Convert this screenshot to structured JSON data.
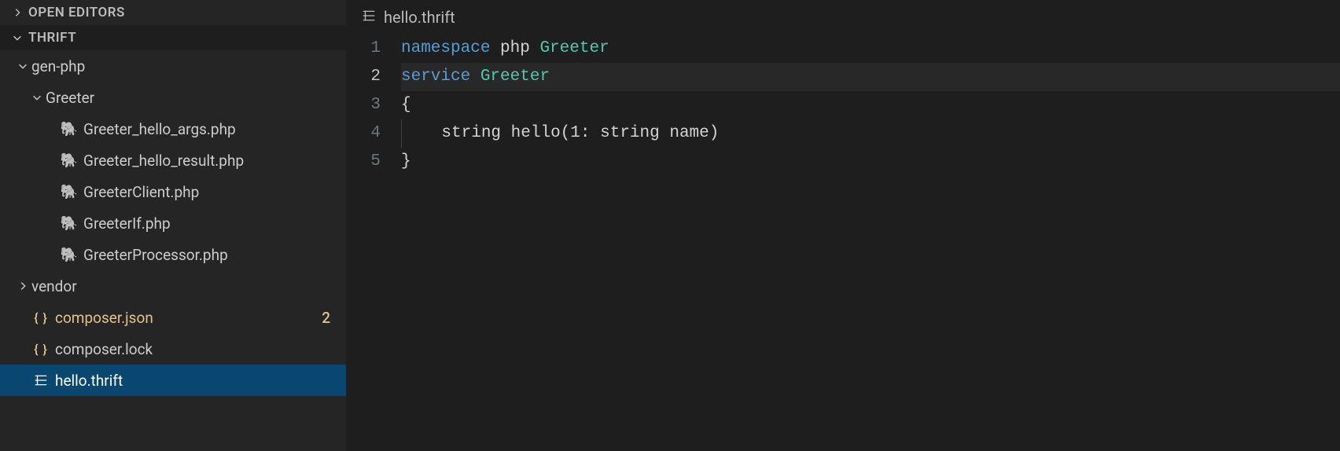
{
  "sidebar": {
    "open_editors_label": "OPEN EDITORS",
    "workspace_label": "THRIFT",
    "tree": [
      {
        "kind": "folder",
        "name": "gen-php",
        "depth": 0,
        "expanded": true
      },
      {
        "kind": "folder",
        "name": "Greeter",
        "depth": 1,
        "expanded": true
      },
      {
        "kind": "file",
        "name": "Greeter_hello_args.php",
        "depth": 2,
        "icon": "php"
      },
      {
        "kind": "file",
        "name": "Greeter_hello_result.php",
        "depth": 2,
        "icon": "php"
      },
      {
        "kind": "file",
        "name": "GreeterClient.php",
        "depth": 2,
        "icon": "php"
      },
      {
        "kind": "file",
        "name": "GreeterIf.php",
        "depth": 2,
        "icon": "php"
      },
      {
        "kind": "file",
        "name": "GreeterProcessor.php",
        "depth": 2,
        "icon": "php"
      },
      {
        "kind": "folder",
        "name": "vendor",
        "depth": 0,
        "expanded": false
      },
      {
        "kind": "file",
        "name": "composer.json",
        "depth": 0,
        "icon": "json",
        "modified": true,
        "badge": "2"
      },
      {
        "kind": "file",
        "name": "composer.lock",
        "depth": 0,
        "icon": "json"
      },
      {
        "kind": "file",
        "name": "hello.thrift",
        "depth": 0,
        "icon": "thrift",
        "selected": true
      }
    ]
  },
  "editor": {
    "tab_filename": "hello.thrift",
    "current_line": 2,
    "lines": [
      {
        "n": 1,
        "tokens": [
          {
            "t": "namespace",
            "c": "keyword"
          },
          {
            "t": " ",
            "c": ""
          },
          {
            "t": "php",
            "c": "name"
          },
          {
            "t": " ",
            "c": ""
          },
          {
            "t": "Greeter",
            "c": "type"
          }
        ]
      },
      {
        "n": 2,
        "hl": true,
        "tokens": [
          {
            "t": "service",
            "c": "keyword"
          },
          {
            "t": " ",
            "c": ""
          },
          {
            "t": "Greeter",
            "c": "type"
          }
        ]
      },
      {
        "n": 3,
        "tokens": [
          {
            "t": "{",
            "c": "punc"
          }
        ]
      },
      {
        "n": 4,
        "indent_guide": true,
        "tokens": [
          {
            "t": "    ",
            "c": ""
          },
          {
            "t": "string",
            "c": "builtin"
          },
          {
            "t": " ",
            "c": ""
          },
          {
            "t": "hello",
            "c": "name"
          },
          {
            "t": "(",
            "c": "punc"
          },
          {
            "t": "1",
            "c": "name"
          },
          {
            "t": ":",
            "c": "punc"
          },
          {
            "t": " ",
            "c": ""
          },
          {
            "t": "string",
            "c": "builtin"
          },
          {
            "t": " ",
            "c": ""
          },
          {
            "t": "name",
            "c": "name"
          },
          {
            "t": ")",
            "c": "punc"
          }
        ]
      },
      {
        "n": 5,
        "tokens": [
          {
            "t": "}",
            "c": "punc"
          }
        ]
      }
    ]
  }
}
